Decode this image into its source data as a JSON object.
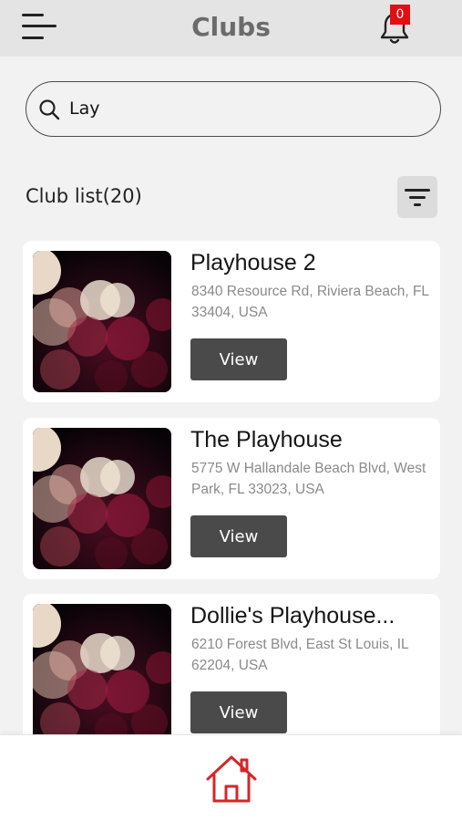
{
  "header": {
    "title": "Clubs",
    "notification_count": "0",
    "menu_icon": "hamburger-menu-icon",
    "notification_icon": "bell-icon"
  },
  "search": {
    "value": "Lay",
    "icon": "search-icon"
  },
  "list": {
    "title": "Club list(20)",
    "filter_icon": "filter-icon"
  },
  "clubs": [
    {
      "name": "Playhouse 2",
      "address": "8340 Resource Rd, Riviera Beach, FL 33404, USA",
      "button_label": "View"
    },
    {
      "name": "The Playhouse",
      "address": "5775 W Hallandale Beach Blvd, West Park, FL 33023, USA",
      "button_label": "View"
    },
    {
      "name": "Dollie's Playhouse...",
      "address": "6210 Forest Blvd, East St Louis, IL 62204, USA",
      "button_label": "View"
    }
  ],
  "bottom_nav": {
    "home_icon": "home-icon"
  },
  "colors": {
    "accent": "#d6262a",
    "badge": "#e10f12",
    "button": "#4a4a4a",
    "background": "#f2f2f2"
  }
}
